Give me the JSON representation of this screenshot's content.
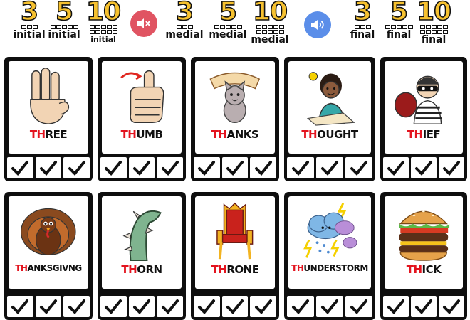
{
  "toolbar": {
    "initial": [
      {
        "num": "3",
        "label": "initial",
        "boxes": 3
      },
      {
        "num": "5",
        "label": "initial",
        "boxes": 5
      },
      {
        "num": "10",
        "label": "initial",
        "boxes": 10
      }
    ],
    "medial": [
      {
        "num": "3",
        "label": "medial",
        "boxes": 3
      },
      {
        "num": "5",
        "label": "medial",
        "boxes": 5
      },
      {
        "num": "10",
        "label": "medial",
        "boxes": 10
      }
    ],
    "final": [
      {
        "num": "3",
        "label": "final",
        "boxes": 3
      },
      {
        "num": "5",
        "label": "final",
        "boxes": 5
      },
      {
        "num": "10",
        "label": "final",
        "boxes": 10
      }
    ],
    "mute_icon": "speaker-mute-icon",
    "unmute_icon": "speaker-on-icon"
  },
  "colors": {
    "accent_gold": "#f6c12f",
    "th_red": "#e3141f",
    "mute_red": "#e05462",
    "sound_blue": "#5b8ee9",
    "card_black": "#0e0e0e"
  },
  "cards": [
    {
      "th": "TH",
      "rest": "REE",
      "icon": "three-fingers-hand-icon"
    },
    {
      "th": "TH",
      "rest": "UMB",
      "icon": "thumbs-up-icon"
    },
    {
      "th": "TH",
      "rest": "ANKS",
      "icon": "thanks-cat-icon"
    },
    {
      "th": "TH",
      "rest": "OUGHT",
      "icon": "thinking-girl-icon"
    },
    {
      "th": "TH",
      "rest": "IEF",
      "icon": "thief-icon"
    },
    {
      "th": "TH",
      "rest": "ANKSGIVNG",
      "icon": "turkey-icon"
    },
    {
      "th": "TH",
      "rest": "ORN",
      "icon": "thorn-vine-icon"
    },
    {
      "th": "TH",
      "rest": "RONE",
      "icon": "throne-icon"
    },
    {
      "th": "TH",
      "rest": "UNDERSTORM",
      "icon": "storm-cloud-icon"
    },
    {
      "th": "TH",
      "rest": "ICK",
      "icon": "burger-icon"
    }
  ],
  "checks_per_card": 3
}
